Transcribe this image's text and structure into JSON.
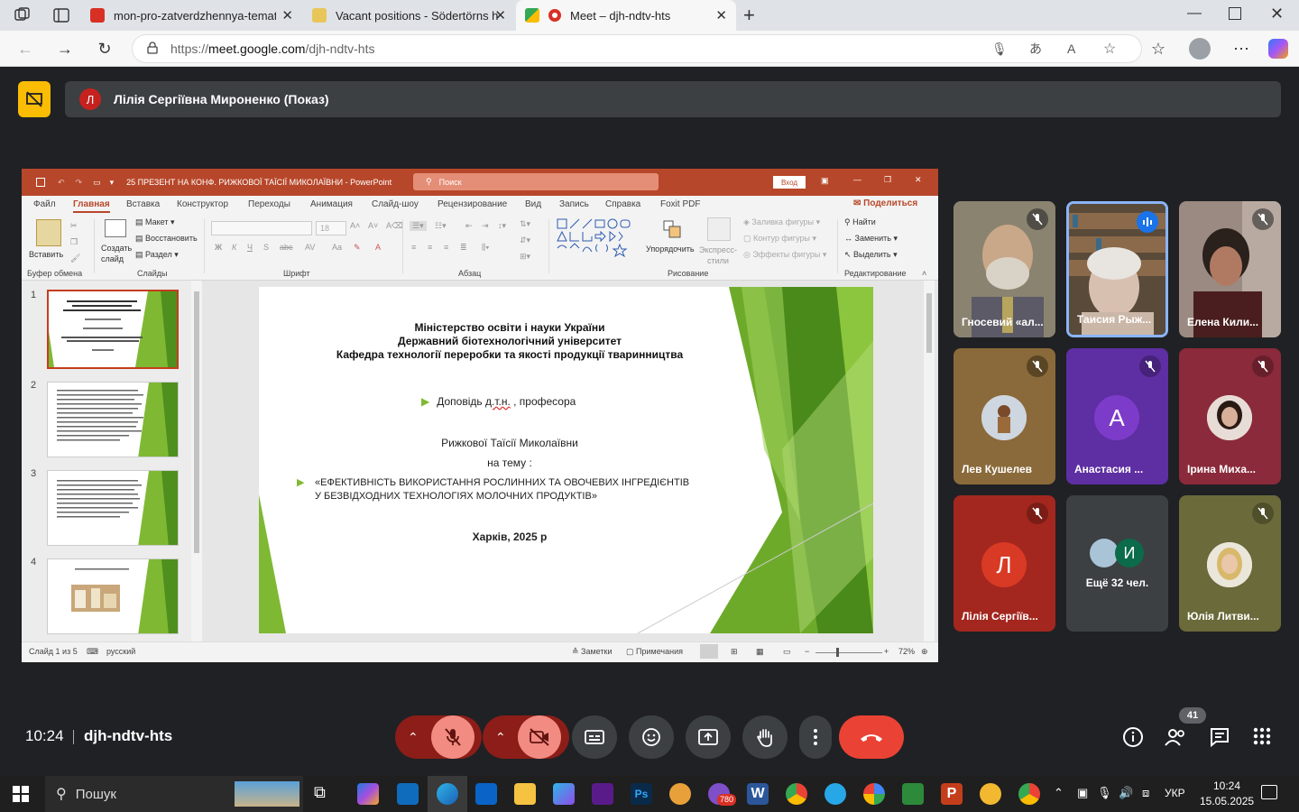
{
  "browser": {
    "tabs": [
      {
        "title": "mon-pro-zatverdzhennya-tematik",
        "active": false
      },
      {
        "title": "Vacant positions - Södertörns hög",
        "active": false
      },
      {
        "title": "Meet – djh-ndtv-hts",
        "active": true
      }
    ],
    "url_prefix": "https://",
    "url_host": "meet.google.com",
    "url_path": "/djh-ndtv-hts"
  },
  "meet": {
    "presenter_initial": "Л",
    "presenter_banner": "Лілія Сергіївна Мироненко (Показ)",
    "time": "10:24",
    "meeting_code": "djh-ndtv-hts",
    "participants_count": "41",
    "participants": [
      {
        "name": "Гносевий «ал...",
        "muted": true
      },
      {
        "name": "Таисия Рыж...",
        "muted": false,
        "speaking": true
      },
      {
        "name": "Елена Кили...",
        "muted": true
      },
      {
        "name": "Лев Кушелев",
        "muted": true
      },
      {
        "name": "Анастасия ...",
        "muted": true,
        "initial": "А"
      },
      {
        "name": "Ірина Миха...",
        "muted": true
      },
      {
        "name": "Лілія Сергіїв...",
        "muted": true,
        "initial": "Л"
      },
      {
        "name": "Ещё 32 чел.",
        "muted": false,
        "initial": "И"
      },
      {
        "name": "Юлія Литви...",
        "muted": true
      }
    ]
  },
  "ppt": {
    "file_title": "25 ПРЕЗЕНТ НА КОНФ. РИЖКОВОЇ ТАЇСІЇ МИКОЛАЇВНИ  -  PowerPoint",
    "search_placeholder": "Поиск",
    "signin": "Вход",
    "menu": [
      "Файл",
      "Главная",
      "Вставка",
      "Конструктор",
      "Переходы",
      "Анимация",
      "Слайд-шоу",
      "Рецензирование",
      "Вид",
      "Запись",
      "Справка",
      "Foxit PDF"
    ],
    "share": "Поделиться",
    "ribbon": {
      "paste": "Вставить",
      "new_slide": "Создать слайд",
      "layout": "Макет",
      "reset": "Восстановить",
      "section": "Раздел",
      "font_size": "18",
      "arrange": "Упорядочить",
      "quick_styles": "Экспресс-стили",
      "shape_fill": "Заливка фигуры",
      "shape_outline": "Контур фигуры",
      "shape_effects": "Эффекты фигуры",
      "find": "Найти",
      "replace": "Заменить",
      "select": "Выделить",
      "groups": [
        "Буфер обмена",
        "Слайды",
        "Шрифт",
        "Абзац",
        "Рисование",
        "Редактирование"
      ]
    },
    "slide_numbers": [
      "1",
      "2",
      "3",
      "4"
    ],
    "slide": {
      "line1": "Міністерство освіти і науки України",
      "line2": "Державний біотехнологічний  університет",
      "line3": "Кафедра технології переробки та якості  продукції тваринництва",
      "report_pre": "Доповідь ",
      "report_abbr": "д.т.н.",
      "report_post": " , професора",
      "author": "Рижкової Таїсії Миколаївни",
      "topic": "на тему :",
      "title1": "«ЕФЕКТИВНІСТЬ ВИКОРИСТАННЯ РОСЛИННИХ ТА ОВОЧЕВИХ ІНГРЕДІЄНТІВ",
      "title2": "У БЕЗВІДХОДНИХ ТЕХНОЛОГІЯХ МОЛОЧНИХ ПРОДУКТІВ»",
      "place": "Харків, 2025 р"
    },
    "status": {
      "slide_of": "Слайд 1 из 5",
      "lang": "русский",
      "notes": "Заметки",
      "comments": "Примечания",
      "zoom": "72%"
    }
  },
  "taskbar": {
    "search": "Пошук",
    "lang": "УКР",
    "time": "10:24",
    "date": "15.05.2025",
    "viber_badge": "780"
  }
}
